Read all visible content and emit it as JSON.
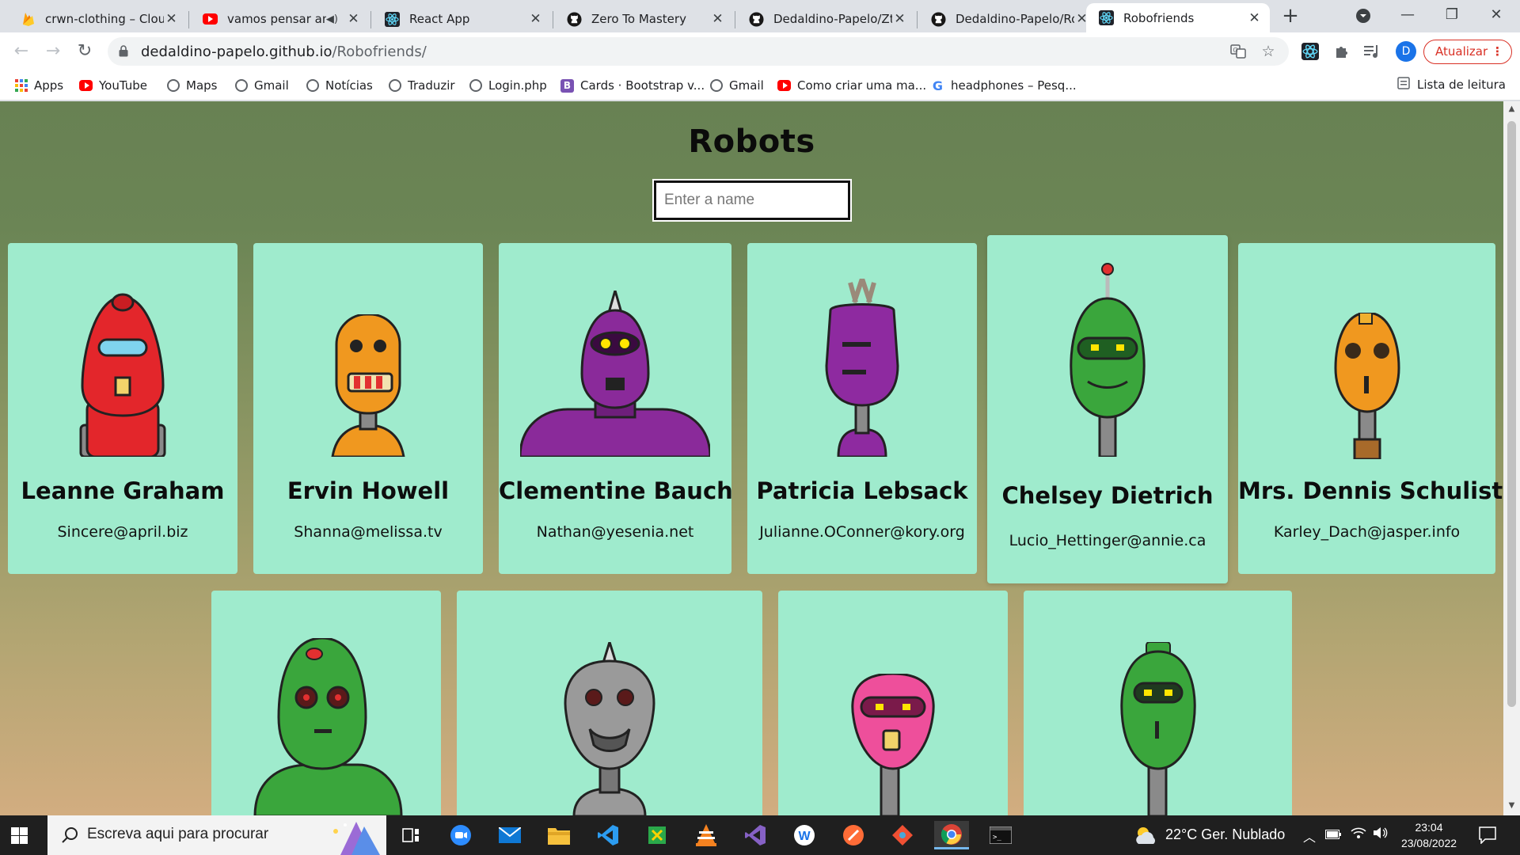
{
  "browser": {
    "tabs": [
      {
        "title": "crwn-clothing – Cloud",
        "icon": "firebase-icon"
      },
      {
        "title": "vamos pensar ang",
        "icon": "youtube-icon",
        "muted": true
      },
      {
        "title": "React App",
        "icon": "react-icon"
      },
      {
        "title": "Zero To Mastery",
        "icon": "github-icon"
      },
      {
        "title": "Dedaldino-Papelo/Zt",
        "icon": "github-icon"
      },
      {
        "title": "Dedaldino-Papelo/Ro",
        "icon": "github-icon"
      },
      {
        "title": "Robofriends",
        "icon": "react-icon",
        "active": true
      }
    ],
    "url_host": "dedaldino-papelo.github.io",
    "url_path": "/Robofriends/",
    "profile_initial": "D",
    "update_label": "Atualizar",
    "bookmarks": [
      {
        "label": "Apps",
        "icon": "apps-grid-icon"
      },
      {
        "label": "YouTube",
        "icon": "youtube-icon"
      },
      {
        "label": "Maps",
        "icon": "globe-icon"
      },
      {
        "label": "Gmail",
        "icon": "globe-icon"
      },
      {
        "label": "Notícias",
        "icon": "globe-icon"
      },
      {
        "label": "Traduzir",
        "icon": "globe-icon"
      },
      {
        "label": "Login.php",
        "icon": "globe-icon"
      },
      {
        "label": "Cards · Bootstrap v...",
        "icon": "bootstrap-icon"
      },
      {
        "label": "Gmail",
        "icon": "globe-icon"
      },
      {
        "label": "Como criar uma ma...",
        "icon": "youtube-icon"
      },
      {
        "label": "headphones – Pesq...",
        "icon": "google-icon"
      }
    ],
    "reading_list": "Lista de leitura"
  },
  "page": {
    "title": "Robots",
    "search_placeholder": "Enter a name",
    "robots": [
      {
        "name": "Leanne Graham",
        "email": "Sincere@april.biz",
        "color": "#e3262b"
      },
      {
        "name": "Ervin Howell",
        "email": "Shanna@melissa.tv",
        "color": "#f0981f"
      },
      {
        "name": "Clementine Bauch",
        "email": "Nathan@yesenia.net",
        "color": "#8a2a9a"
      },
      {
        "name": "Patricia Lebsack",
        "email": "Julianne.OConner@kory.org",
        "color": "#8e2aa0"
      },
      {
        "name": "Chelsey Dietrich",
        "email": "Lucio_Hettinger@annie.ca",
        "color": "#3aa63c"
      },
      {
        "name": "Mrs. Dennis Schulist",
        "email": "Karley_Dach@jasper.info",
        "color": "#f0981f"
      },
      {
        "name": "",
        "email": "",
        "color": "#3aa63c"
      },
      {
        "name": "",
        "email": "",
        "color": "#9a9a9a"
      },
      {
        "name": "",
        "email": "",
        "color": "#ee4f9b"
      },
      {
        "name": "",
        "email": "",
        "color": "#3aa63c"
      }
    ]
  },
  "taskbar": {
    "search_placeholder": "Escreva aqui para procurar",
    "weather": "22°C  Ger. Nublado",
    "time": "23:04",
    "date": "23/08/2022"
  }
}
